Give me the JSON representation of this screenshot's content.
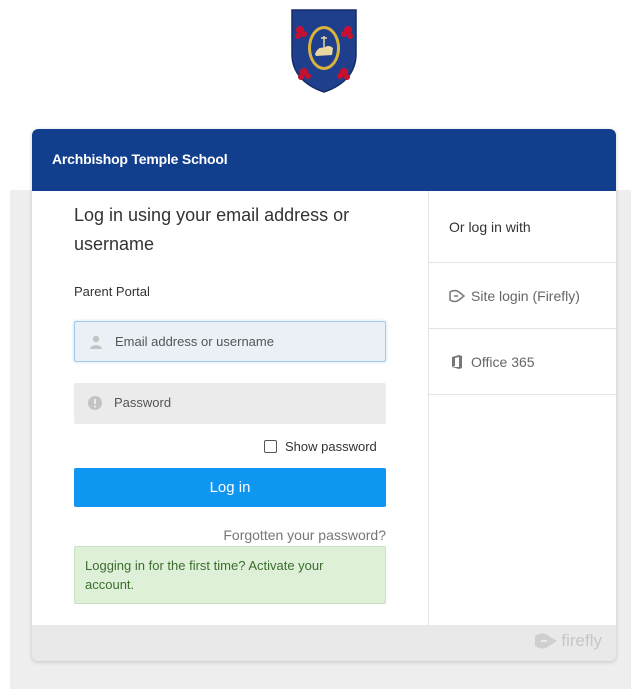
{
  "school_name": "Archbishop Temple School",
  "login": {
    "heading": "Log in using your email address or username",
    "portal_label": "Parent Portal",
    "email_placeholder": "Email address or username",
    "password_placeholder": "Password",
    "show_password_label": "Show password",
    "login_button": "Log in",
    "forgot_link": "Forgotten your password?",
    "activate_text": "Logging in for the first time? Activate your account."
  },
  "alt_login": {
    "heading": "Or log in with",
    "options": [
      {
        "label": "Site login (Firefly)",
        "icon": "firefly-icon"
      },
      {
        "label": "Office 365",
        "icon": "office-365-icon"
      }
    ]
  },
  "footer": {
    "brand": "firefly"
  },
  "colors": {
    "header": "#113f8d",
    "button": "#0f96f0",
    "activate_bg": "#dff0d8",
    "activate_text": "#3c6d2e",
    "crest_blue": "#1f3f8c",
    "crest_red": "#c8102e",
    "crest_gold": "#d8b43c"
  }
}
